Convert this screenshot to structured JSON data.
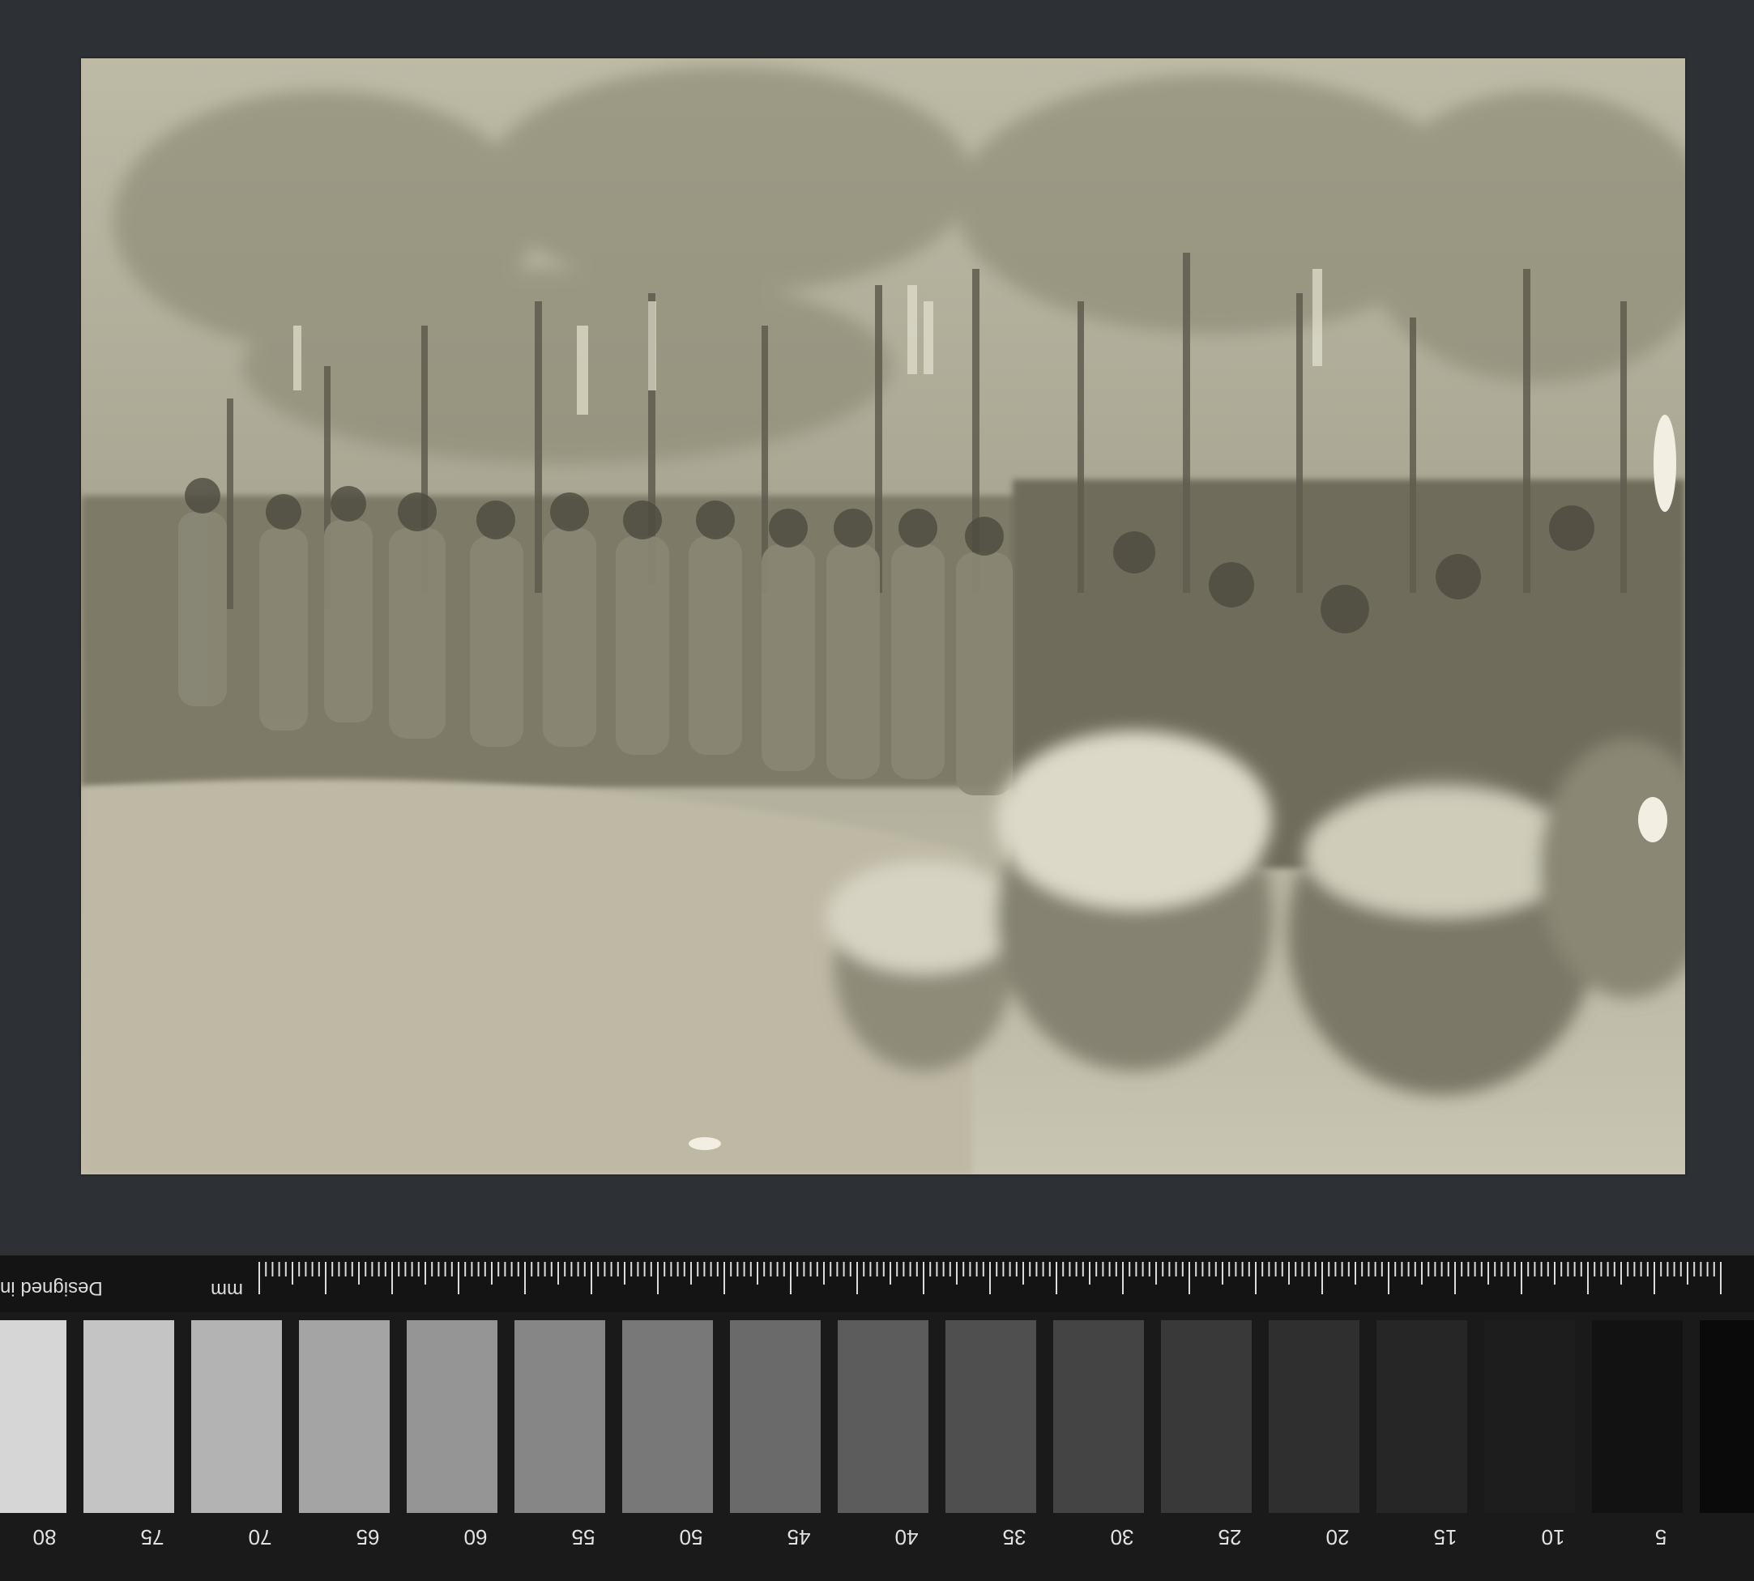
{
  "photo": {
    "subject": "archival-photograph"
  },
  "scale": {
    "brand_text": "Designed in",
    "unit_label": "mm",
    "numbers": [
      "80",
      "75",
      "70",
      "65",
      "60",
      "55",
      "50",
      "45",
      "40",
      "35",
      "30",
      "25",
      "20",
      "15",
      "10",
      "5"
    ],
    "patch_colors": [
      "#d6d6d6",
      "#c4c4c4",
      "#b3b3b3",
      "#a4a4a4",
      "#959595",
      "#868686",
      "#787878",
      "#6a6a6a",
      "#5c5c5c",
      "#4f4f4f",
      "#444444",
      "#393939",
      "#2f2f2f",
      "#262626",
      "#1d1d1d",
      "#121212",
      "#0a0a0a"
    ]
  }
}
